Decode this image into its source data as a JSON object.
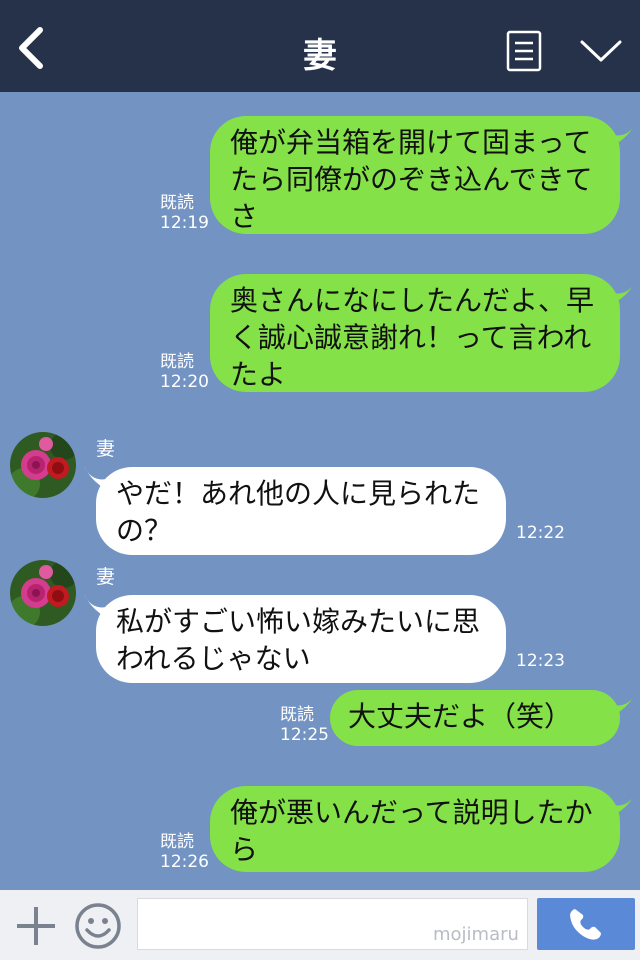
{
  "header": {
    "title": "妻"
  },
  "messages": [
    {
      "type": "out",
      "text": "俺が弁当箱を開けて固まってたら同僚がのぞき込んできてさ",
      "read": "既読",
      "time": "12:19"
    },
    {
      "type": "out",
      "text": "奥さんになにしたんだよ、早く誠心誠意謝れ！って言われたよ",
      "read": "既読",
      "time": "12:20"
    },
    {
      "type": "in",
      "sender": "妻",
      "text": "やだ！あれ他の人に見られたの？",
      "time": "12:22"
    },
    {
      "type": "in",
      "sender": "妻",
      "text": "私がすごい怖い嫁みたいに思われるじゃない",
      "time": "12:23"
    },
    {
      "type": "out",
      "text": "大丈夫だよ（笑）",
      "read": "既読",
      "time": "12:25"
    },
    {
      "type": "out",
      "text": "俺が悪いんだって説明したから",
      "read": "既読",
      "time": "12:26"
    }
  ],
  "footer": {
    "watermark": "mojimaru"
  },
  "colors": {
    "header_bg": "#253249",
    "chat_bg": "#7393c3",
    "out_bubble": "#84e148",
    "in_bubble": "#ffffff",
    "call_button": "#5a89d8"
  },
  "icons": [
    "back-icon",
    "menu-icon",
    "chevron-down-icon",
    "plus-icon",
    "smile-icon",
    "phone-icon"
  ]
}
